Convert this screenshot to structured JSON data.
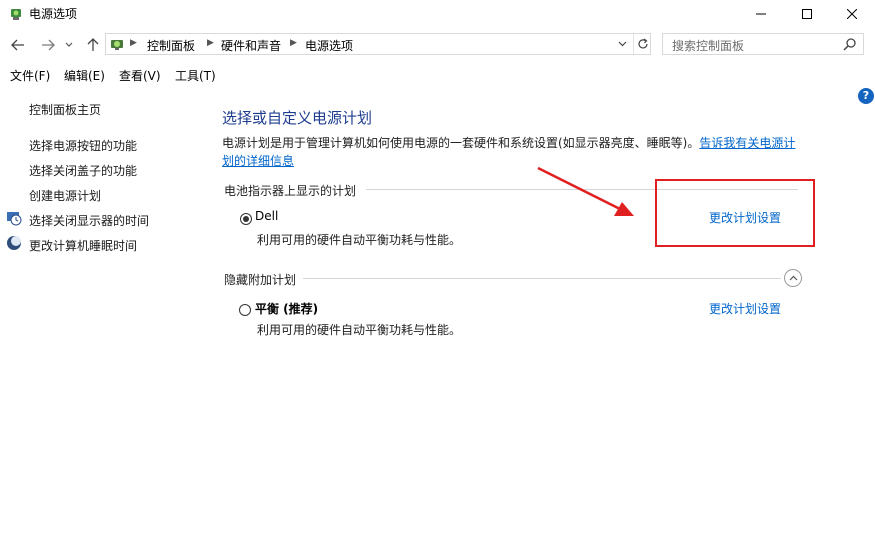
{
  "window": {
    "title": "电源选项",
    "minimize_icon": "minimize-icon",
    "maximize_icon": "maximize-icon",
    "close_icon": "close-icon"
  },
  "nav": {
    "breadcrumbs": [
      "控制面板",
      "硬件和声音",
      "电源选项"
    ],
    "search_placeholder": "搜索控制面板"
  },
  "menu": {
    "items": [
      "文件(F)",
      "编辑(E)",
      "查看(V)",
      "工具(T)"
    ]
  },
  "sidebar": {
    "home": "控制面板主页",
    "items": [
      "选择电源按钮的功能",
      "选择关闭盖子的功能",
      "创建电源计划",
      "选择关闭显示器的时间",
      "更改计算机睡眠时间"
    ]
  },
  "main": {
    "title": "选择或自定义电源计划",
    "description": "电源计划是用于管理计算机如何使用电源的一套硬件和系统设置(如显示器亮度、睡眠等)。",
    "description_link": "告诉我有关电源计划的详细信息",
    "section_battery": "电池指示器上显示的计划",
    "section_hidden": "隐藏附加计划",
    "plans": [
      {
        "name": "Dell",
        "desc": "利用可用的硬件自动平衡功耗与性能。",
        "link": "更改计划设置",
        "selected": true
      },
      {
        "name": "平衡 (推荐)",
        "desc": "利用可用的硬件自动平衡功耗与性能。",
        "link": "更改计划设置",
        "selected": false
      }
    ]
  },
  "colors": {
    "link": "#0066cc",
    "title": "#1e3d8f",
    "highlight": "#e02020"
  }
}
